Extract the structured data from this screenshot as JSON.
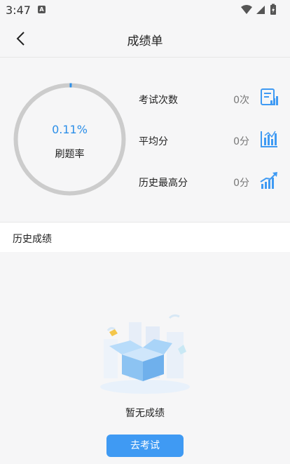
{
  "status_bar": {
    "time": "3:47",
    "notif_badge": "A"
  },
  "header": {
    "title": "成绩单",
    "back_icon": "chevron-left-icon"
  },
  "stats": {
    "rate": {
      "value_text": "0.11%",
      "label": "刷题率",
      "fraction": 0.0011
    },
    "rows": [
      {
        "label": "考试次数",
        "value": "0次",
        "icon": "report-icon"
      },
      {
        "label": "平均分",
        "value": "0分",
        "icon": "bar-chart-icon"
      },
      {
        "label": "历史最高分",
        "value": "0分",
        "icon": "trend-up-icon"
      }
    ]
  },
  "history": {
    "title": "历史成绩",
    "empty_text": "暂无成绩",
    "button_label": "去考试"
  },
  "colors": {
    "accent": "#3f9af3",
    "ring_track": "#cccccc",
    "percent_text": "#2b8ee8"
  }
}
